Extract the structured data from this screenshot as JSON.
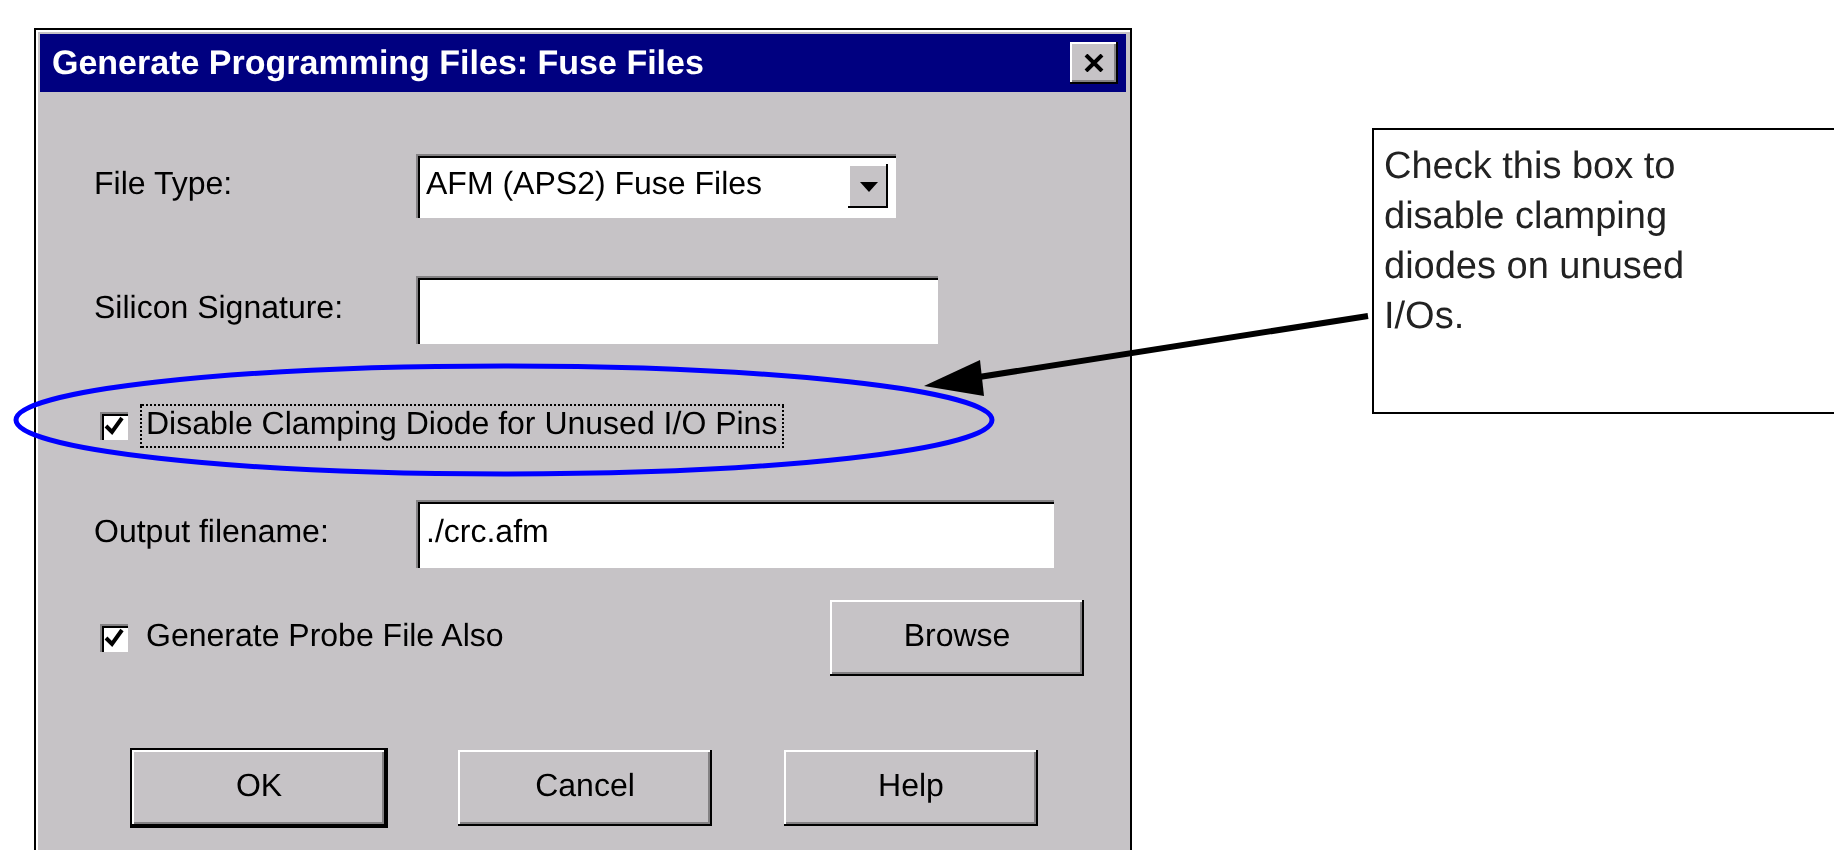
{
  "window": {
    "title": "Generate Programming Files: Fuse Files"
  },
  "file_type": {
    "label": "File Type:",
    "value": "AFM (APS2) Fuse Files"
  },
  "silicon_signature": {
    "label": "Silicon Signature:"
  },
  "disable_clamping": {
    "label": "Disable Clamping Diode for Unused I/O Pins",
    "checked": true,
    "focused": true
  },
  "output_filename": {
    "label": "Output filename:",
    "value": "./crc.afm"
  },
  "generate_probe": {
    "label": "Generate Probe File Also",
    "checked": true,
    "focused": false
  },
  "browse_button": {
    "label": "Browse"
  },
  "buttons": [
    {
      "label": "OK",
      "default": true
    },
    {
      "label": "Cancel",
      "default": false
    },
    {
      "label": "Help",
      "default": false
    }
  ],
  "callout": {
    "text": "Check this box to disable clamping diodes on unused I/Os."
  }
}
